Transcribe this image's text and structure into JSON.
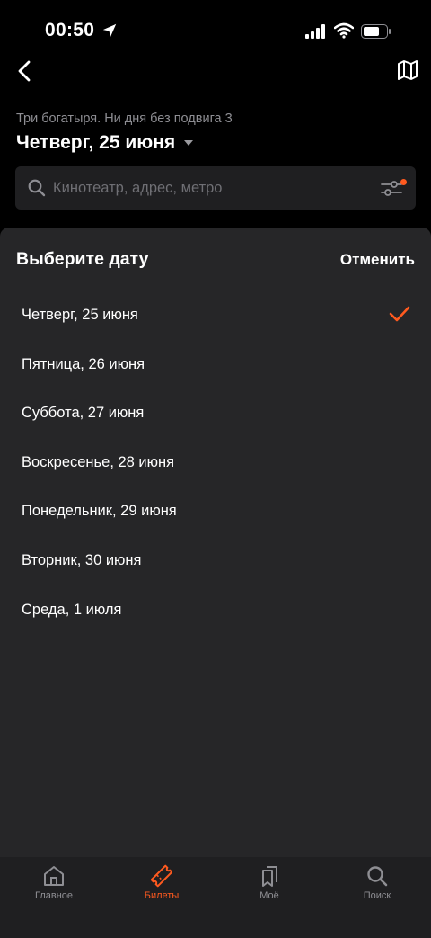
{
  "status_bar": {
    "time": "00:50"
  },
  "header": {
    "movie_title": "Три богатыря. Ни дня без подвига 3",
    "selected_date": "Четверг, 25 июня"
  },
  "search": {
    "placeholder": "Кинотеатр, адрес, метро",
    "filter_indicator_color": "#ff5a1f"
  },
  "sheet": {
    "title": "Выберите дату",
    "cancel_label": "Отменить",
    "selected_index": 0,
    "dates": [
      {
        "label": "Четверг, 25 июня",
        "selected": true
      },
      {
        "label": "Пятница, 26 июня",
        "selected": false
      },
      {
        "label": "Суббота, 27 июня",
        "selected": false
      },
      {
        "label": "Воскресенье, 28 июня",
        "selected": false
      },
      {
        "label": "Понедельник, 29 июня",
        "selected": false
      },
      {
        "label": "Вторник, 30 июня",
        "selected": false
      },
      {
        "label": "Среда, 1 июля",
        "selected": false
      }
    ]
  },
  "tab_bar": {
    "active_tab": "tickets",
    "tabs": [
      {
        "id": "home",
        "label": "Главное",
        "icon": "home-icon"
      },
      {
        "id": "tickets",
        "label": "Билеты",
        "icon": "ticket-icon"
      },
      {
        "id": "mine",
        "label": "Моё",
        "icon": "bookmark-icon"
      },
      {
        "id": "search",
        "label": "Поиск",
        "icon": "search-icon"
      }
    ]
  },
  "colors": {
    "accent": "#ff5a1f",
    "background": "#000000",
    "sheet": "#262628",
    "muted_text": "#8e8e93"
  }
}
